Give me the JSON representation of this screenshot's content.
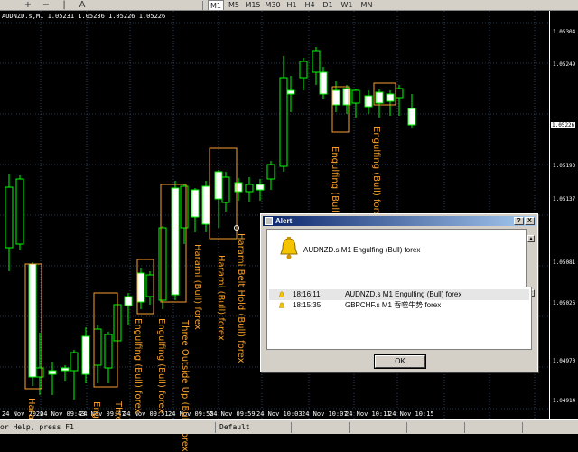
{
  "toolbar": {
    "icons": [
      "crosshair-icon",
      "hline-icon",
      "vline-icon",
      "text-icon"
    ],
    "timeframes": [
      "M1",
      "M5",
      "M15",
      "M30",
      "H1",
      "H4",
      "D1",
      "W1",
      "MN"
    ],
    "active_timeframe": "M1"
  },
  "chart": {
    "header": "AUDNZD.s,M1  1.05231 1.05236 1.05226 1.05226",
    "background": "#000000",
    "bull_color": "#00ff00",
    "bear_color": "#ffffff",
    "annotation_color": "#f7a12b",
    "grid_color": "#4a6a9a"
  },
  "price_axis": {
    "labels": [
      "1.05304",
      "1.05249",
      "1.05226",
      "1.05193",
      "1.05137",
      "1.05081",
      "1.05026",
      "1.04970",
      "1.04914"
    ],
    "current_price": "1.05226"
  },
  "date_axis": {
    "labels": [
      "24 Nov 2020",
      "24 Nov 09:43",
      "24 Nov 09:47",
      "24 Nov 09:51",
      "24 Nov 09:55",
      "24 Nov 09:59",
      "24 Nov 10:03",
      "24 Nov 10:07",
      "24 Nov 10:11",
      "24 Nov 10:15"
    ]
  },
  "annotations": [
    "Harami",
    "Engul",
    "Three",
    "Engulfing (Bull) forex",
    "Engulfing (Bull) forex",
    "Three Outside Up (Bull) forex",
    "Harami (Bull) forex",
    "Harami (Bull) forex",
    "Harami Belt Hold (Bull) forex",
    "Engulfing (Bull) forex",
    "Engulfing (Bull) forex"
  ],
  "statusbar": {
    "help": "or Help, press F1",
    "profile": "Default"
  },
  "alert_dialog": {
    "title": "Alert",
    "help_button": "?",
    "close_button": "X",
    "message": "AUDNZD.s M1 Engulfing (Bull) forex",
    "rows": [
      {
        "time": "18:16:11",
        "message": "AUDNZD.s M1 Engulfing (Bull) forex"
      },
      {
        "time": "18:15:35",
        "message": "GBPCHF.s M1 吞噬牛势 forex"
      }
    ],
    "ok_label": "OK"
  }
}
